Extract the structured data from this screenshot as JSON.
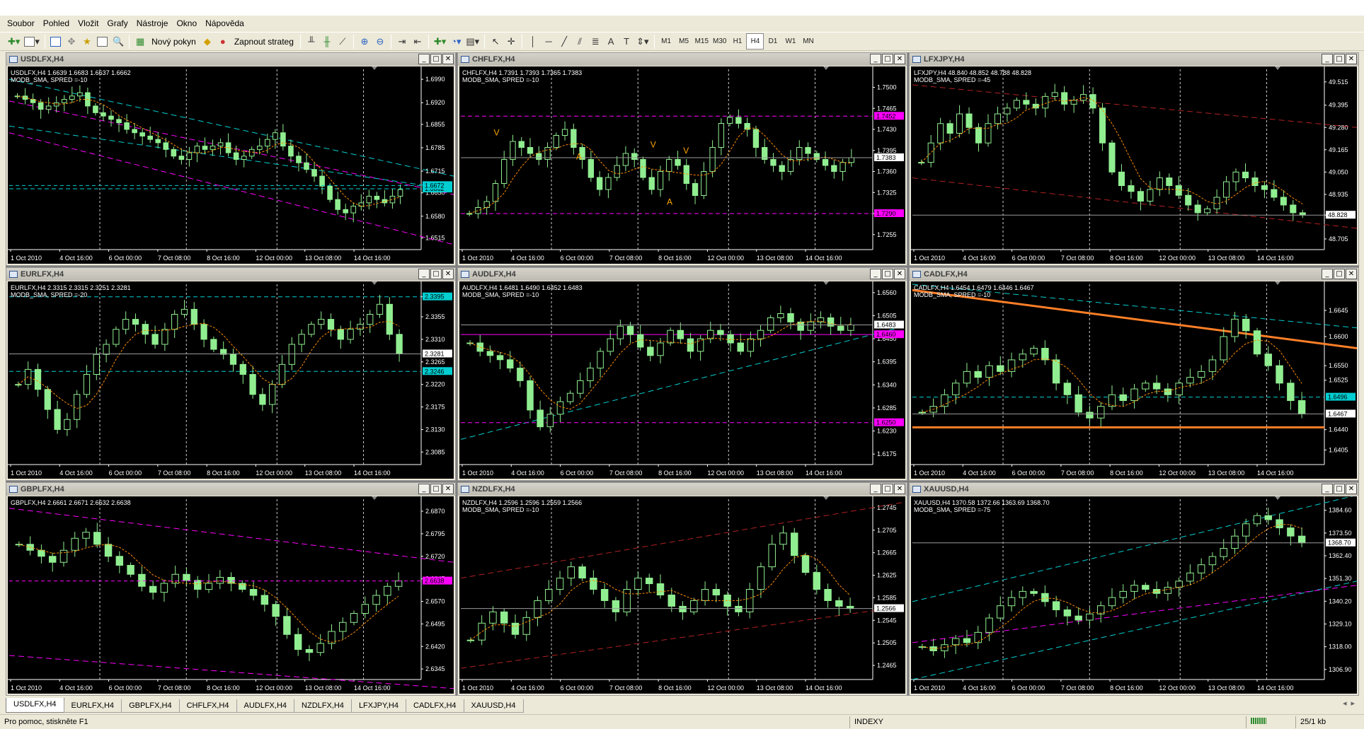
{
  "menu": [
    "Soubor",
    "Pohled",
    "Vložit",
    "Grafy",
    "Nástroje",
    "Okno",
    "Nápověda"
  ],
  "toolbar": {
    "new_order": "Nový pokyn",
    "strategy": "Zapnout strateg",
    "timeframes": [
      "M1",
      "M5",
      "M15",
      "M30",
      "H1",
      "H4",
      "D1",
      "W1",
      "MN"
    ],
    "active_timeframe": "H4"
  },
  "tabs": [
    "USDLFX,H4",
    "EURLFX,H4",
    "GBPLFX,H4",
    "CHFLFX,H4",
    "AUDLFX,H4",
    "NZDLFX,H4",
    "LFXJPY,H4",
    "CADLFX,H4",
    "XAUUSD,H4"
  ],
  "active_tab": "USDLFX,H4",
  "status": {
    "help": "Pro pomoc, stiskněte F1",
    "profile": "INDEXY",
    "conn": "25/1 kb"
  },
  "colors": {
    "candle": "#90ee90",
    "ma": "#ff8c00",
    "cyan": "#00ced1",
    "magenta": "#ff00ff",
    "red": "#b22222",
    "orange": "#ff7f27",
    "text": "#ffffff"
  },
  "x_labels": [
    "1 Oct 2010",
    "4 Oct 16:00",
    "6 Oct 00:00",
    "7 Oct 08:00",
    "8 Oct 16:00",
    "12 Oct 00:00",
    "13 Oct 08:00",
    "14 Oct 16:00"
  ],
  "chart_data": [
    {
      "type": "candlestick",
      "title": "USDLFX,H4",
      "info": "USDLFX,H4  1.6639 1.6683 1.6637 1.6662",
      "indicator": "MODB_SMA, SPRED =-10",
      "ylim": [
        1.648,
        1.702
      ],
      "y_ticks": [
        "1.6990",
        "1.6920",
        "1.6855",
        "1.6785",
        "1.6715",
        "1.6650",
        "1.6580",
        "1.6515"
      ],
      "closes": [
        1.694,
        1.693,
        1.692,
        1.69,
        1.691,
        1.692,
        1.693,
        1.694,
        1.695,
        1.691,
        1.689,
        1.688,
        1.687,
        1.686,
        1.684,
        1.683,
        1.682,
        1.681,
        1.68,
        1.678,
        1.676,
        1.675,
        1.677,
        1.679,
        1.678,
        1.679,
        1.68,
        1.677,
        1.675,
        1.676,
        1.678,
        1.679,
        1.681,
        1.683,
        1.679,
        1.676,
        1.674,
        1.672,
        1.67,
        1.667,
        1.663,
        1.66,
        1.659,
        1.661,
        1.662,
        1.664,
        1.663,
        1.662,
        1.664,
        1.666
      ],
      "price": {
        "value": "1.6672",
        "color": "#00ced1",
        "dashed": true
      },
      "hlines": [
        {
          "value": 1.6662,
          "label": "1.6662",
          "color": "#00ced1",
          "dashed": true
        }
      ],
      "lines": [
        [
          1.699,
          1.67,
          "#00ced1"
        ],
        [
          1.6925,
          1.6645,
          "#ff00ff"
        ],
        [
          1.683,
          1.6495,
          "#ff00ff"
        ],
        [
          1.685,
          1.666,
          "#00ced1"
        ]
      ]
    },
    {
      "type": "candlestick",
      "title": "CHFLFX,H4",
      "info": "CHFLFX,H4  1.7391 1.7393 1.7365 1.7383",
      "indicator": "MODB_SMA, SPRED =-10",
      "ylim": [
        1.723,
        1.753
      ],
      "y_ticks": [
        "1.7500",
        "1.7465",
        "1.7430",
        "1.7395",
        "1.7360",
        "1.7325",
        "1.7290",
        "1.7255"
      ],
      "closes": [
        1.729,
        1.73,
        1.731,
        1.734,
        1.738,
        1.741,
        1.74,
        1.739,
        1.738,
        1.74,
        1.742,
        1.743,
        1.74,
        1.738,
        1.735,
        1.733,
        1.735,
        1.737,
        1.739,
        1.738,
        1.735,
        1.733,
        1.736,
        1.738,
        1.737,
        1.734,
        1.732,
        1.736,
        1.74,
        1.744,
        1.745,
        1.744,
        1.743,
        1.74,
        1.738,
        1.737,
        1.736,
        1.738,
        1.74,
        1.739,
        1.738,
        1.737,
        1.736,
        1.7375,
        1.7383
      ],
      "price": {
        "value": "1.7383",
        "color": "#ffffff",
        "dashed": false
      },
      "hlines": [
        {
          "value": 1.7452,
          "label": "1.7452",
          "color": "#ff00ff",
          "dashed": true
        },
        {
          "value": 1.729,
          "label": "1.7290",
          "color": "#ff00ff",
          "dashed": true
        }
      ],
      "lines": [
        [
          null,
          null,
          ""
        ]
      ],
      "markers": [
        {
          "t": "V",
          "x": 0.08,
          "v": 1.742
        },
        {
          "t": "A",
          "x": 0.28,
          "v": 1.738
        },
        {
          "t": "V",
          "x": 0.46,
          "v": 1.74
        },
        {
          "t": "V",
          "x": 0.54,
          "v": 1.739
        },
        {
          "t": "A",
          "x": 0.5,
          "v": 1.7305
        }
      ]
    },
    {
      "type": "candlestick",
      "title": "LFXJPY,H4",
      "info": "LFXJPY,H4  48.840 48.852 48.788 48.828",
      "indicator": "MODB_SMA, SPRED =-45",
      "ylim": [
        48.65,
        49.58
      ],
      "y_ticks": [
        "49.515",
        "49.395",
        "49.280",
        "49.165",
        "49.050",
        "48.935",
        "48.828",
        "48.705"
      ],
      "closes": [
        49.1,
        49.2,
        49.3,
        49.25,
        49.35,
        49.28,
        49.2,
        49.3,
        49.35,
        49.38,
        49.42,
        49.4,
        49.38,
        49.44,
        49.46,
        49.4,
        49.42,
        49.45,
        49.38,
        49.2,
        49.05,
        48.98,
        48.95,
        48.9,
        48.96,
        49.02,
        48.98,
        48.93,
        48.88,
        48.84,
        48.86,
        48.92,
        49.0,
        49.05,
        49.02,
        48.98,
        48.96,
        48.92,
        48.88,
        48.84,
        48.828
      ],
      "price": {
        "value": "48.828",
        "color": "#ffffff",
        "dashed": false
      },
      "hlines": [],
      "lines": [
        [
          49.5,
          49.28,
          "#b22222"
        ],
        [
          49.02,
          48.76,
          "#b22222"
        ]
      ]
    },
    {
      "type": "candlestick",
      "title": "EURLFX,H4",
      "info": "EURLFX,H4  2.3315 2.3315 2.3251 2.3281",
      "indicator": "MODB_SMA, SPRED =-20",
      "ylim": [
        2.306,
        2.342
      ],
      "y_ticks": [
        "2.3395",
        "2.3355",
        "2.3310",
        "2.3265",
        "2.3220",
        "2.3175",
        "2.3130",
        "2.3085"
      ],
      "closes": [
        2.322,
        2.325,
        2.321,
        2.317,
        2.313,
        2.315,
        2.32,
        2.324,
        2.328,
        2.33,
        2.333,
        2.335,
        2.334,
        2.332,
        2.33,
        2.333,
        2.336,
        2.337,
        2.334,
        2.331,
        2.329,
        2.328,
        2.326,
        2.324,
        2.32,
        2.318,
        2.322,
        2.326,
        2.33,
        2.332,
        2.334,
        2.335,
        2.333,
        2.331,
        2.333,
        2.334,
        2.336,
        2.338,
        2.332,
        2.3281
      ],
      "price": {
        "value": "2.3281",
        "color": "#ffffff",
        "dashed": false
      },
      "hlines": [
        {
          "value": 2.3395,
          "label": "2.3395",
          "color": "#00ced1",
          "dashed": true
        },
        {
          "value": 2.3246,
          "label": "2.3246",
          "color": "#00ced1",
          "dashed": true
        }
      ],
      "lines": []
    },
    {
      "type": "candlestick",
      "title": "AUDLFX,H4",
      "info": "AUDLFX,H4  1.6481 1.6490 1.6452 1.6483",
      "indicator": "MODB_SMA, SPRED =-10",
      "ylim": [
        1.615,
        1.658
      ],
      "y_ticks": [
        "1.6560",
        "1.6505",
        "1.6450",
        "1.6395",
        "1.6340",
        "1.6285",
        "1.6230",
        "1.6175"
      ],
      "closes": [
        1.644,
        1.642,
        1.641,
        1.64,
        1.638,
        1.635,
        1.628,
        1.624,
        1.627,
        1.63,
        1.632,
        1.635,
        1.638,
        1.642,
        1.645,
        1.648,
        1.646,
        1.643,
        1.641,
        1.644,
        1.647,
        1.645,
        1.642,
        1.645,
        1.647,
        1.646,
        1.644,
        1.642,
        1.645,
        1.647,
        1.65,
        1.651,
        1.649,
        1.647,
        1.649,
        1.65,
        1.648,
        1.647,
        1.6483
      ],
      "price": {
        "value": "1.6483",
        "color": "#ffffff",
        "dashed": false
      },
      "hlines": [
        {
          "value": 1.646,
          "label": "1.6460",
          "color": "#ff00ff",
          "dashed": false
        },
        {
          "value": 1.625,
          "label": "1.6250",
          "color": "#ff00ff",
          "dashed": true
        }
      ],
      "lines": [
        [
          1.621,
          1.648,
          "#00ced1"
        ]
      ]
    },
    {
      "type": "candlestick",
      "title": "CADLFX,H4",
      "info": "CADLFX,H4  1.6454 1.6479 1.6446 1.6467",
      "indicator": "MODB_SMA, SPRED =-10",
      "ylim": [
        1.638,
        1.669
      ],
      "y_ticks": [
        "1.6645",
        "1.6600",
        "1.6550",
        "1.6525",
        "1.6440",
        "1.6405"
      ],
      "closes": [
        1.647,
        1.648,
        1.65,
        1.652,
        1.654,
        1.653,
        1.655,
        1.654,
        1.656,
        1.657,
        1.658,
        1.656,
        1.652,
        1.65,
        1.647,
        1.646,
        1.648,
        1.65,
        1.649,
        1.651,
        1.652,
        1.651,
        1.65,
        1.652,
        1.653,
        1.654,
        1.656,
        1.66,
        1.663,
        1.661,
        1.657,
        1.655,
        1.652,
        1.649,
        1.6467
      ],
      "price": {
        "value": "1.6467",
        "color": "#ffffff",
        "dashed": false
      },
      "hlines": [
        {
          "value": 1.6496,
          "label": "1.6496",
          "color": "#00ced1",
          "dashed": true
        },
        {
          "value": 1.6444,
          "label": "",
          "color": "#ff7f27",
          "dashed": false,
          "width": 3
        }
      ],
      "lines": [
        [
          1.668,
          1.658,
          "#ff7f27",
          3
        ],
        [
          1.669,
          1.6615,
          "#00ced1"
        ]
      ]
    },
    {
      "type": "candlestick",
      "title": "GBPLFX,H4",
      "info": "GBPLFX,H4  2.6661 2.6671 2.6632 2.6638",
      "indicator": "",
      "ylim": [
        2.631,
        2.691
      ],
      "y_ticks": [
        "2.6870",
        "2.6795",
        "2.6720",
        "2.6645",
        "2.6570",
        "2.6495",
        "2.6420",
        "2.6345"
      ],
      "closes": [
        2.676,
        2.674,
        2.672,
        2.67,
        2.674,
        2.678,
        2.68,
        2.676,
        2.672,
        2.669,
        2.666,
        2.662,
        2.66,
        2.663,
        2.666,
        2.664,
        2.661,
        2.663,
        2.665,
        2.663,
        2.661,
        2.659,
        2.656,
        2.652,
        2.646,
        2.641,
        2.64,
        2.643,
        2.647,
        2.65,
        2.653,
        2.656,
        2.659,
        2.662,
        2.6638
      ],
      "price": {
        "value": "2.6638",
        "color": "#ff00ff",
        "dashed": true
      },
      "hlines": [],
      "lines": [
        [
          2.688,
          2.67,
          "#ff00ff"
        ],
        [
          2.639,
          2.628,
          "#ff00ff"
        ]
      ]
    },
    {
      "type": "candlestick",
      "title": "NZDLFX,H4",
      "info": "NZDLFX,H4  1.2596 1.2596 1.2559 1.2566",
      "indicator": "MODB_SMA, SPRED =-10",
      "ylim": [
        1.244,
        1.276
      ],
      "y_ticks": [
        "1.2745",
        "1.2705",
        "1.2665",
        "1.2625",
        "1.2585",
        "1.2545",
        "1.2505",
        "1.2465"
      ],
      "closes": [
        1.251,
        1.254,
        1.256,
        1.254,
        1.252,
        1.255,
        1.258,
        1.26,
        1.262,
        1.264,
        1.262,
        1.26,
        1.258,
        1.256,
        1.26,
        1.262,
        1.261,
        1.259,
        1.257,
        1.256,
        1.258,
        1.26,
        1.259,
        1.257,
        1.256,
        1.26,
        1.264,
        1.268,
        1.27,
        1.266,
        1.263,
        1.26,
        1.258,
        1.257,
        1.2566
      ],
      "price": {
        "value": "1.2566",
        "color": "#ffffff",
        "dashed": false
      },
      "hlines": [],
      "lines": [
        [
          1.262,
          1.2755,
          "#b22222"
        ],
        [
          1.246,
          1.257,
          "#b22222"
        ]
      ]
    },
    {
      "type": "candlestick",
      "title": "XAUUSD,H4",
      "info": "XAUUSD,H4  1370.58 1372.66 1363.69 1368.70",
      "indicator": "MODB_SMA, SPRED =-75",
      "ylim": [
        1302.0,
        1390.0
      ],
      "y_ticks": [
        "1384.60",
        "1373.50",
        "1362.40",
        "1351.30",
        "1340.20",
        "1329.10",
        "1318.00",
        "1306.90"
      ],
      "closes": [
        1318,
        1316,
        1319,
        1322,
        1320,
        1325,
        1332,
        1338,
        1342,
        1345,
        1344,
        1340,
        1336,
        1333,
        1331,
        1334,
        1338,
        1342,
        1345,
        1348,
        1346,
        1344,
        1347,
        1350,
        1354,
        1358,
        1362,
        1366,
        1372,
        1378,
        1382,
        1380,
        1376,
        1372,
        1368.7
      ],
      "price": {
        "value": "1368.70",
        "color": "#ffffff",
        "dashed": false
      },
      "hlines": [],
      "lines": [
        [
          1340,
          1392,
          "#00ced1"
        ],
        [
          1302,
          1350,
          "#00ced1"
        ],
        [
          1320,
          1348,
          "#ff00ff"
        ]
      ]
    }
  ]
}
